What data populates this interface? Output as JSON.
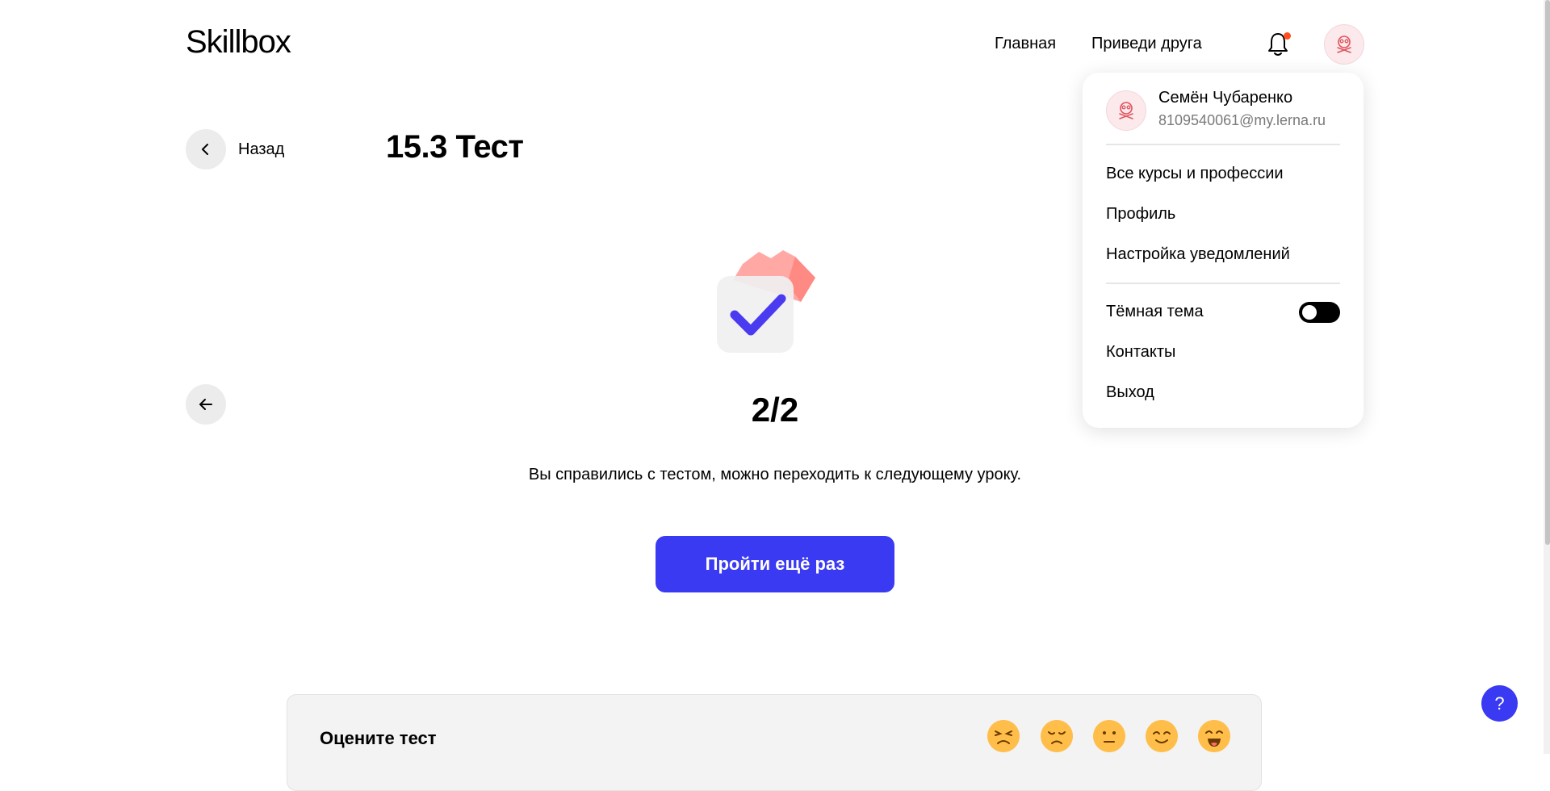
{
  "header": {
    "logo": "Skillbox",
    "nav": [
      "Главная",
      "Приведи друга"
    ],
    "bell_icon": "bell-icon",
    "avatar_icon": "owl-avatar-icon"
  },
  "lesson": {
    "back_label": "Назад",
    "title": "15.3 Тест"
  },
  "result": {
    "score": "2/2",
    "message": "Вы справились с тестом, можно переходить к следующему уроку.",
    "retry_label": "Пройти ещё раз"
  },
  "rating": {
    "title": "Оцените тест",
    "emojis": [
      "angry-face-icon",
      "sad-face-icon",
      "neutral-face-icon",
      "smiling-face-icon",
      "happy-face-icon"
    ]
  },
  "user_menu": {
    "name": "Семён Чубаренко",
    "email": "8109540061@my.lerna.ru",
    "items_top": [
      "Все курсы и профессии",
      "Профиль",
      "Настройка уведомлений"
    ],
    "dark_theme_label": "Тёмная тема",
    "dark_theme_on": false,
    "items_bottom": [
      "Контакты",
      "Выход"
    ]
  },
  "help": {
    "label": "?"
  },
  "colors": {
    "accent": "#3a3af3",
    "notification_dot": "#ff4f1f",
    "emoji": "#ffbe4a"
  }
}
